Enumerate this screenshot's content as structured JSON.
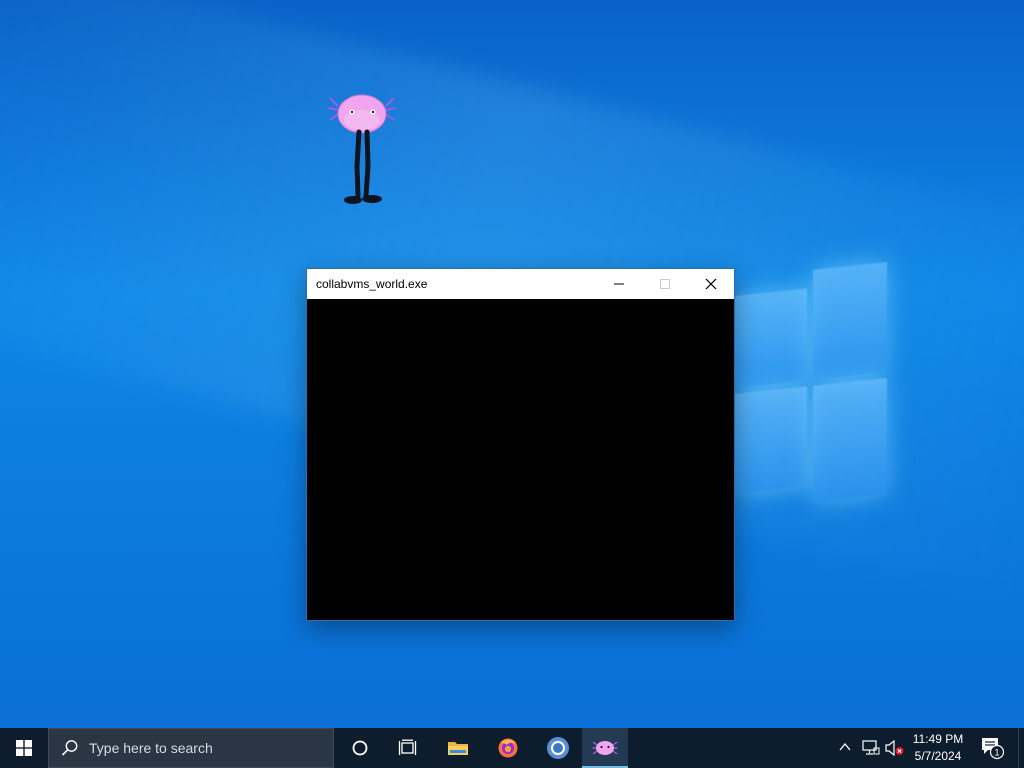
{
  "window": {
    "title": "collabvms_world.exe",
    "controls": [
      "minimize",
      "maximize",
      "close"
    ]
  },
  "taskbar": {
    "search_placeholder": "Type here to search",
    "pinned_apps": [
      {
        "name": "Cortana",
        "icon": "cortana-icon"
      },
      {
        "name": "Task View",
        "icon": "task-view-icon"
      },
      {
        "name": "File Explorer",
        "icon": "folder-icon"
      },
      {
        "name": "Firefox",
        "icon": "firefox-icon"
      },
      {
        "name": "Chrome",
        "icon": "chrome-icon"
      },
      {
        "name": "collabvms_world.exe",
        "icon": "axolotl-icon",
        "active": true
      }
    ],
    "clock": {
      "time": "11:49 PM",
      "date": "5/7/2024"
    },
    "notification_count": "1"
  },
  "colors": {
    "desktop_bg": "#0e86e6",
    "taskbar_bg": "#0d1d2e",
    "window_client": "#000000",
    "accent": "#76b9ed"
  }
}
